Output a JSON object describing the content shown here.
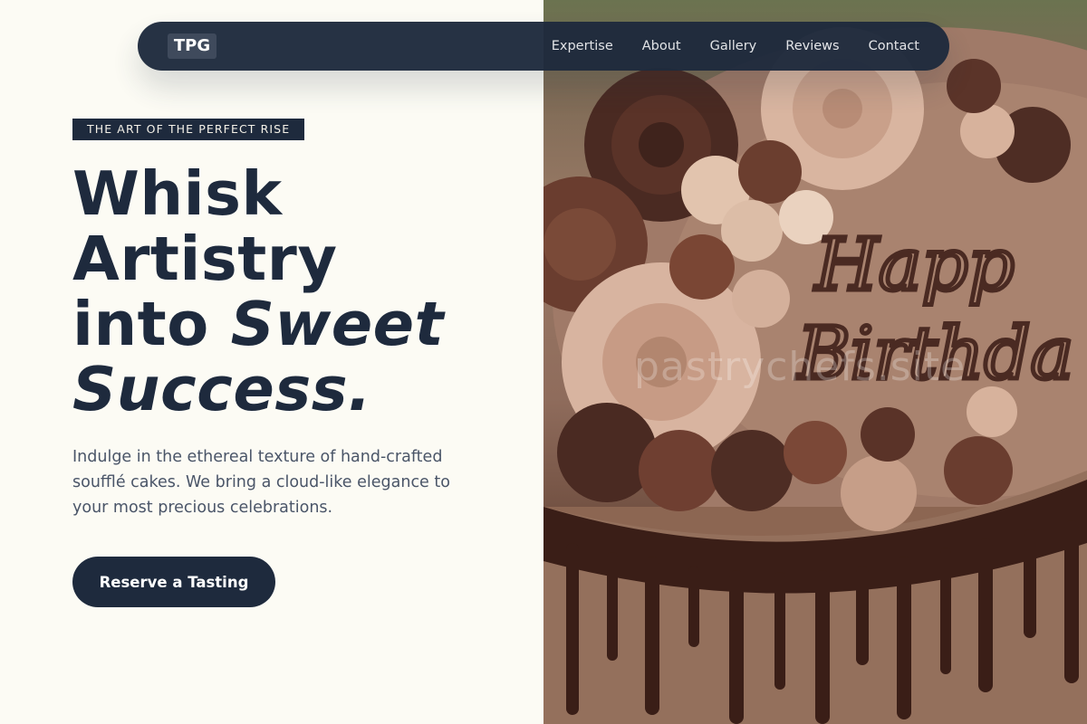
{
  "brand": {
    "logo_text": "TPG"
  },
  "nav": {
    "items": [
      {
        "label": "Expertise"
      },
      {
        "label": "About"
      },
      {
        "label": "Gallery"
      },
      {
        "label": "Reviews"
      },
      {
        "label": "Contact"
      }
    ]
  },
  "hero": {
    "eyebrow": "THE ART OF THE PERFECT RISE",
    "headline_line1": "Whisk",
    "headline_line2": "Artistry",
    "headline_line3_plain": "into",
    "headline_line3_italic": "Sweet",
    "headline_line4_italic": "Success.",
    "intro": "Indulge in the ethereal texture of hand-crafted soufflé cakes. We bring a cloud-like elegance to your most precious celebrations.",
    "cta_label": "Reserve a Tasting"
  },
  "image": {
    "watermark": "pastrychefs.site",
    "cake_text_line1": "Happ",
    "cake_text_line2": "Birthda"
  }
}
